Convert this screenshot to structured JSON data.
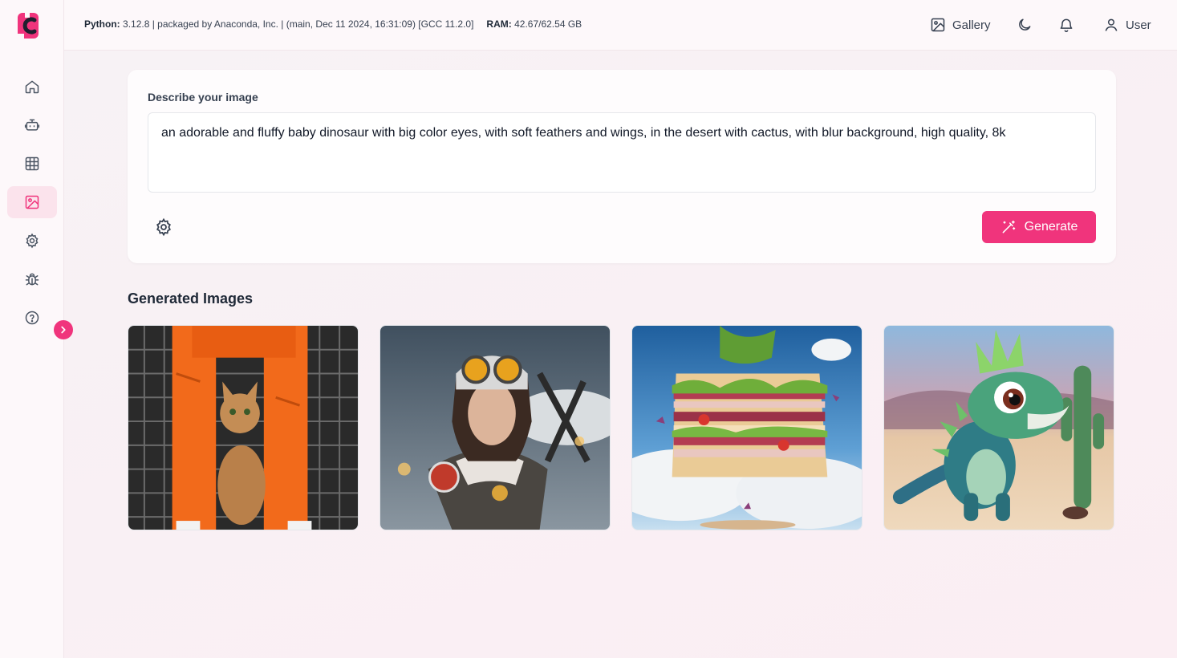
{
  "header": {
    "python_label": "Python:",
    "python_value": "3.12.8 | packaged by Anaconda, Inc. | (main, Dec 11 2024, 16:31:09) [GCC 11.2.0]",
    "ram_label": "RAM:",
    "ram_value": "42.67/62.54 GB",
    "gallery_label": "Gallery",
    "user_label": "User"
  },
  "sidebar": {
    "items": [
      {
        "icon": "home-icon",
        "active": false
      },
      {
        "icon": "robot-icon",
        "active": false
      },
      {
        "icon": "table-icon",
        "active": false
      },
      {
        "icon": "image-icon",
        "active": true
      },
      {
        "icon": "gear-icon",
        "active": false
      },
      {
        "icon": "bug-icon",
        "active": false
      },
      {
        "icon": "help-icon",
        "active": false
      }
    ]
  },
  "prompt_card": {
    "label": "Describe your image",
    "value": "an adorable and fluffy baby dinosaur with big color eyes, with soft feathers and wings, in the desert with cactus, with blur background, high quality, 8k",
    "generate_label": "Generate"
  },
  "gallery": {
    "title": "Generated Images",
    "images": [
      {
        "subject": "cat between orange prison pants legs"
      },
      {
        "subject": "woman pilot with goggles in snow"
      },
      {
        "subject": "floating layered sandwich in sky"
      },
      {
        "subject": "baby dinosaur in desert with cactus"
      }
    ]
  },
  "colors": {
    "accent": "#f0347c",
    "active_bg": "#fbe3ec"
  }
}
